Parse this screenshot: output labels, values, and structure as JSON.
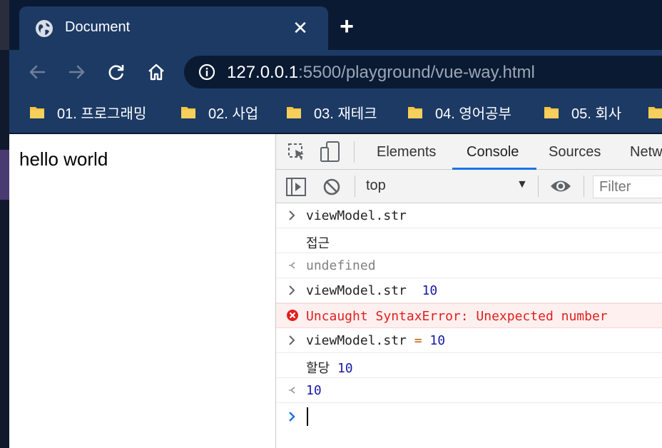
{
  "browser": {
    "tab_title": "Document",
    "url_host": "127.0.0.1",
    "url_rest": ":5500/playground/vue-way.html"
  },
  "bookmarks": [
    {
      "label": "01. 프로그래밍"
    },
    {
      "label": "02. 사업"
    },
    {
      "label": "03. 재테크"
    },
    {
      "label": "04. 영어공부"
    },
    {
      "label": "05. 회사"
    }
  ],
  "page": {
    "text": "hello world"
  },
  "devtools": {
    "tabs": [
      "Elements",
      "Console",
      "Sources",
      "Netw"
    ],
    "active_tab": "Console",
    "context": "top",
    "filter_placeholder": "Filter"
  },
  "console": {
    "lines": [
      {
        "kind": "input",
        "text": "viewModel.str"
      },
      {
        "kind": "log",
        "text": "접근"
      },
      {
        "kind": "result",
        "text": "undefined"
      },
      {
        "kind": "input",
        "text": "viewModel.str",
        "num": "10"
      },
      {
        "kind": "error",
        "text": "Uncaught SyntaxError: Unexpected number"
      },
      {
        "kind": "input",
        "text": "viewModel.str",
        "op": "=",
        "num": "10"
      },
      {
        "kind": "log",
        "text": "할당",
        "num": "10"
      },
      {
        "kind": "result",
        "num": "10"
      }
    ]
  },
  "colors": {
    "accent": "#1a73e8",
    "error": "#e0201e",
    "number": "#1a1aa6",
    "chrome_bg": "#1c3a64",
    "bookmark_folder": "#f5c542"
  }
}
